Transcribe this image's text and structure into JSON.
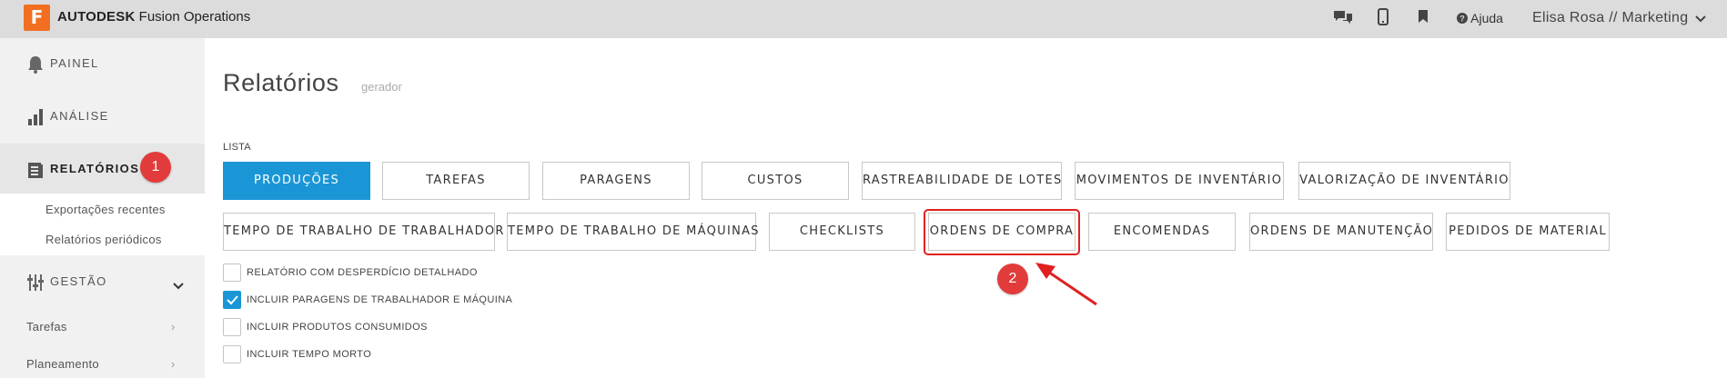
{
  "topbar": {
    "logo_letter": "F",
    "brand_bold": "AUTODESK",
    "brand_rest": " Fusion Operations",
    "help_label": "Ajuda",
    "user_label": "Elisa Rosa // Marketing"
  },
  "sidebar": {
    "nav": [
      {
        "label": "PAINEL"
      },
      {
        "label": "ANÁLISE"
      },
      {
        "label": "RELATÓRIOS"
      },
      {
        "label": "GESTÃO"
      }
    ],
    "sub_items": [
      "Exportações recentes",
      "Relatórios periódicos"
    ],
    "groups": [
      "Tarefas",
      "Planeamento"
    ]
  },
  "page": {
    "title": "Relatórios",
    "subtitle": "gerador",
    "list_label": "LISTA"
  },
  "report_buttons_row1": [
    "PRODUÇÕES",
    "TAREFAS",
    "PARAGENS",
    "CUSTOS",
    "RASTREABILIDADE DE LOTES",
    "MOVIMENTOS DE INVENTÁRIO",
    "VALORIZAÇÃO DE INVENTÁRIO"
  ],
  "report_buttons_row2": [
    "TEMPO DE TRABALHO DE TRABALHADOR",
    "TEMPO DE TRABALHO DE MÁQUINAS",
    "CHECKLISTS",
    "ORDENS DE COMPRA",
    "ENCOMENDAS",
    "ORDENS DE MANUTENÇÃO",
    "PEDIDOS DE MATERIAL"
  ],
  "active_report": "PRODUÇÕES",
  "options": [
    {
      "label": "RELATÓRIO COM DESPERDÍCIO DETALHADO",
      "checked": false
    },
    {
      "label": "INCLUIR PARAGENS DE TRABALHADOR E MÁQUINA",
      "checked": true
    },
    {
      "label": "INCLUIR PRODUTOS CONSUMIDOS",
      "checked": false
    },
    {
      "label": "INCLUIR TEMPO MORTO",
      "checked": false
    }
  ],
  "annotations": {
    "badge1": "1",
    "badge2": "2"
  },
  "colors": {
    "accent": "#1a96d6",
    "logo": "#f26f22",
    "annotation": "#e23b3b"
  }
}
